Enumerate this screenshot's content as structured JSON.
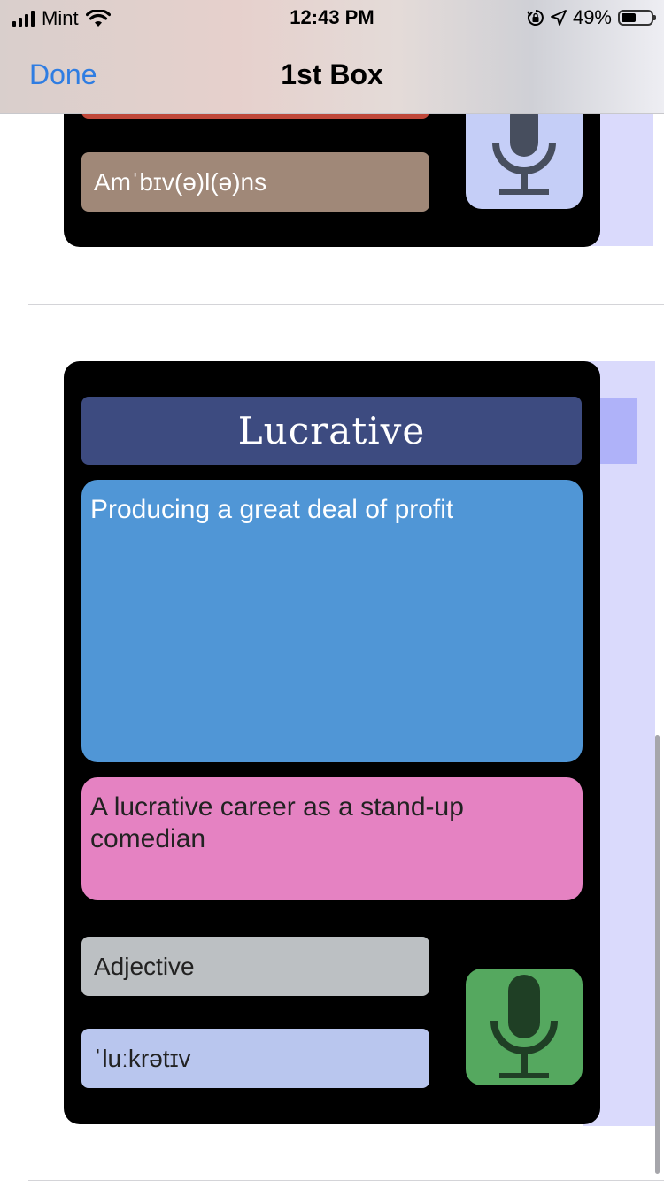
{
  "status_bar": {
    "carrier": "Mint",
    "time": "12:43 PM",
    "battery_percent": "49%",
    "battery_level": 0.49
  },
  "nav": {
    "back_label": "Done",
    "title": "1st Box"
  },
  "cards": [
    {
      "pronunciation": "Amˈbɪv(ə)l(ə)ns",
      "mic_color": "#c5cef7",
      "mic_icon_color": "#474e5e"
    },
    {
      "word": "Lucrative",
      "definition": "Producing a great deal of profit",
      "example": "A lucrative career as a stand-up comedian",
      "part_of_speech": "Adjective",
      "pronunciation": "ˈluːkrətɪv",
      "mic_color": "#55a85f",
      "mic_icon_color": "#1f3f25"
    }
  ],
  "colors": {
    "accent": "#2f7de2",
    "title_bg": "#3d4b80",
    "definition_bg": "#5096d6",
    "example_bg": "#e582c2",
    "pos_bg": "#bcc0c3",
    "pron_bg": "#b9c6ee",
    "card_bg": "#000000"
  }
}
